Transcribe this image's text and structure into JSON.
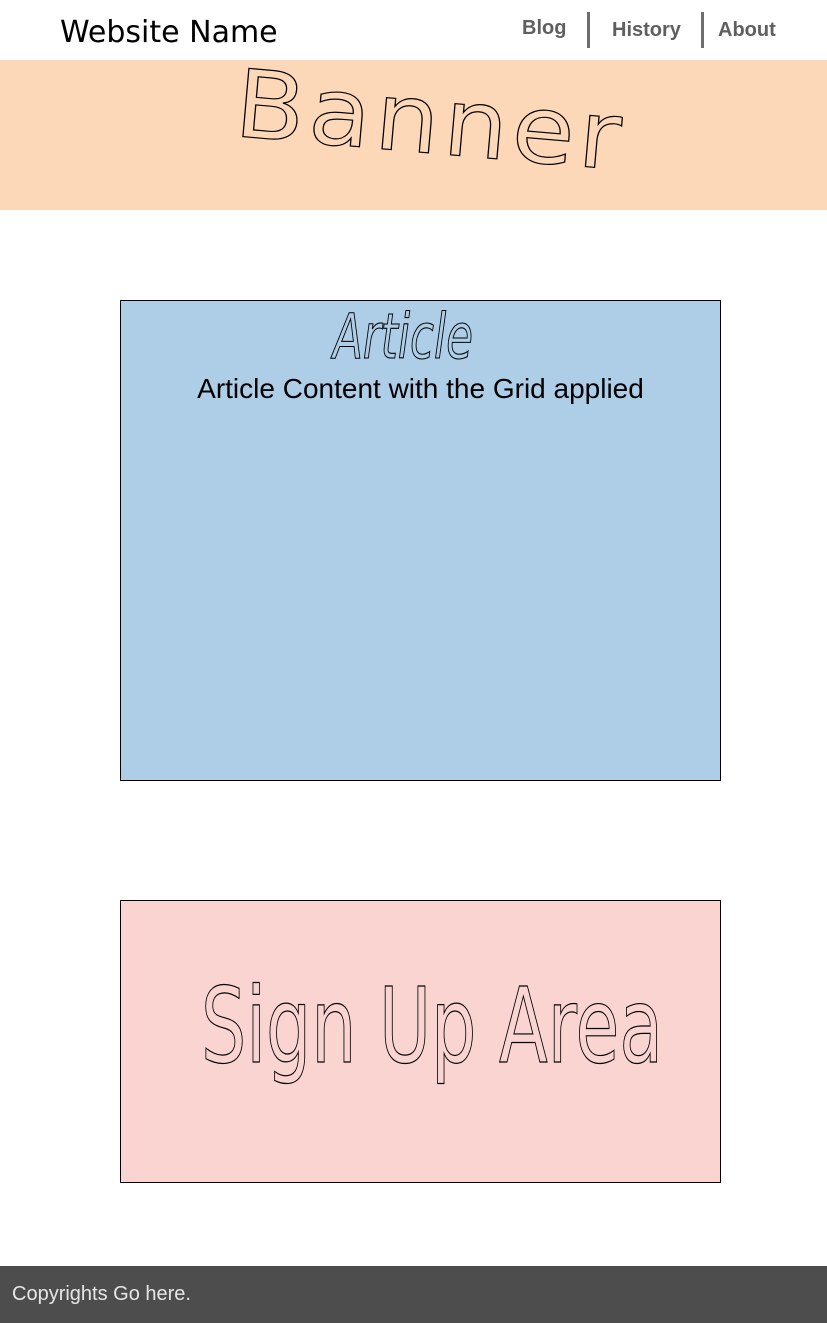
{
  "header": {
    "site_name": "Website Name",
    "nav": {
      "blog": "Blog",
      "history": "History",
      "about": "About"
    }
  },
  "banner": {
    "label": "Banner",
    "color": "#fdd8b8"
  },
  "article": {
    "heading": "Article",
    "content": "Article Content with the Grid applied",
    "color": "#aecde6"
  },
  "signup": {
    "label": "Sign Up Area",
    "color": "#fad4d1"
  },
  "footer": {
    "text": "Copyrights Go here.",
    "color": "#4d4d4d"
  }
}
